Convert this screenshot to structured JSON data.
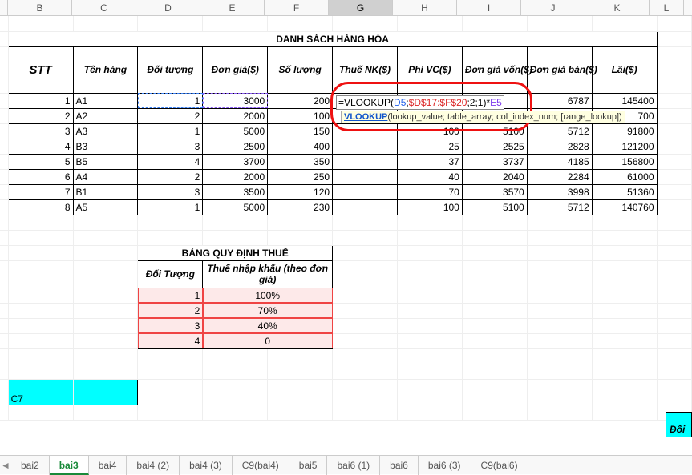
{
  "columns": [
    "B",
    "C",
    "D",
    "E",
    "F",
    "G",
    "H",
    "I",
    "J",
    "K",
    "L"
  ],
  "activeCol": "G",
  "title": "DANH SÁCH HÀNG HÓA",
  "headers": {
    "stt": "STT",
    "ten": "Tên hàng",
    "doituong": "Đối tượng",
    "dongia": "Đơn giá($)",
    "soluong": "Số lượng",
    "thue": "Thuế NK($)",
    "phivc": "Phí VC($)",
    "dgvon": "Đơn giá vốn($)",
    "dgban": "Đơn giá bán($)",
    "lai": "Lãi($)"
  },
  "rows": [
    {
      "stt": "1",
      "ten": "A1",
      "dt": "1",
      "dg": "3000",
      "sl": "200",
      "thue": "",
      "phi": "",
      "von": "",
      "ban": "6787",
      "lai": "145400"
    },
    {
      "stt": "2",
      "ten": "A2",
      "dt": "2",
      "dg": "2000",
      "sl": "100",
      "thue": "",
      "phi": "",
      "von": "",
      "ban": "",
      "lai": "700"
    },
    {
      "stt": "3",
      "ten": "A3",
      "dt": "1",
      "dg": "5000",
      "sl": "150",
      "thue": "",
      "phi": "100",
      "von": "5100",
      "ban": "5712",
      "lai": "91800"
    },
    {
      "stt": "4",
      "ten": "B3",
      "dt": "3",
      "dg": "2500",
      "sl": "400",
      "thue": "",
      "phi": "25",
      "von": "2525",
      "ban": "2828",
      "lai": "121200"
    },
    {
      "stt": "5",
      "ten": "B5",
      "dt": "4",
      "dg": "3700",
      "sl": "350",
      "thue": "",
      "phi": "37",
      "von": "3737",
      "ban": "4185",
      "lai": "156800"
    },
    {
      "stt": "6",
      "ten": "A4",
      "dt": "2",
      "dg": "2000",
      "sl": "250",
      "thue": "",
      "phi": "40",
      "von": "2040",
      "ban": "2284",
      "lai": "61000"
    },
    {
      "stt": "7",
      "ten": "B1",
      "dt": "3",
      "dg": "3500",
      "sl": "120",
      "thue": "",
      "phi": "70",
      "von": "3570",
      "ban": "3998",
      "lai": "51360"
    },
    {
      "stt": "8",
      "ten": "A5",
      "dt": "1",
      "dg": "5000",
      "sl": "230",
      "thue": "",
      "phi": "100",
      "von": "5100",
      "ban": "5712",
      "lai": "140760"
    }
  ],
  "sl_partial": "200",
  "formula": {
    "prefix": "=VLOOKUP(",
    "ref1": "D5",
    "sep1": ";",
    "ref2": "$D$17:$F$20",
    "sep2": ";2;1)*",
    "ref3": "E5"
  },
  "tooltip": {
    "link": "VLOOKUP",
    "rest": "(lookup_value; table_array; col_index_num; [range_lookup])"
  },
  "table2": {
    "title": "BẢNG QUY ĐỊNH THUẾ",
    "h1": "Đối Tượng",
    "h2": "Thuế nhập khẩu (theo đơn giá)",
    "rows": [
      {
        "dt": "1",
        "v": "100%"
      },
      {
        "dt": "2",
        "v": "70%"
      },
      {
        "dt": "3",
        "v": "40%"
      },
      {
        "dt": "4",
        "v": "0"
      }
    ]
  },
  "nameBox": "C7",
  "rightLabel": "Đối tư",
  "tabs": [
    "bai2",
    "bai3",
    "bai4",
    "bai4 (2)",
    "bai4 (3)",
    "C9(bai4)",
    "bai5",
    "bai6 (1)",
    "bai6",
    "bai6 (3)",
    "C9(bai6)"
  ],
  "activeTab": "bai3",
  "chart_data": null
}
